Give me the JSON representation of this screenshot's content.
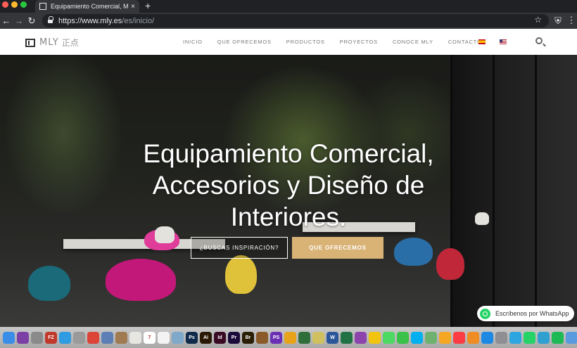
{
  "browser": {
    "tab_title": "Equipamiento Comercial, Mobili",
    "tab_close": "×",
    "new_tab": "+",
    "url_host": "https://www.mly.es",
    "url_path": "/es/inicio/"
  },
  "header": {
    "logo_text": "MLY",
    "logo_cn": "正点",
    "menu": [
      "INICIO",
      "QUE OFRECEMOS",
      "PRODUCTOS",
      "PROYECTOS",
      "CONOCE MLY",
      "CONTACTO"
    ]
  },
  "hero": {
    "title_line1": "Equipamiento Comercial,",
    "title_line2": "Accesorios y Diseño de",
    "title_line3": "Interiores.",
    "btn_inspiration": "¿BUSCAS INSPIRACIÓN?",
    "btn_offer": "QUE OFRECEMOS"
  },
  "whatsapp": {
    "label": "Escríbenos por WhatsApp"
  },
  "colors": {
    "accent_gold": "#d9b275",
    "whatsapp_green": "#25d366"
  },
  "dock_icons": [
    {
      "name": "finder-icon",
      "color": "#3b8ee8",
      "label": ""
    },
    {
      "name": "siri-icon",
      "color": "#7b3fa5",
      "label": ""
    },
    {
      "name": "launchpad-icon",
      "color": "#8a8a8a",
      "label": ""
    },
    {
      "name": "filezilla-icon",
      "color": "#c0392b",
      "label": "FZ"
    },
    {
      "name": "safari-icon",
      "color": "#2f9be0",
      "label": ""
    },
    {
      "name": "tools-icon",
      "color": "#9a9a9a",
      "label": ""
    },
    {
      "name": "chrome-icon",
      "color": "#db4437",
      "label": ""
    },
    {
      "name": "photos-icon",
      "color": "#5d7fb5",
      "label": ""
    },
    {
      "name": "contacts-icon",
      "color": "#a07a50",
      "label": ""
    },
    {
      "name": "notes-icon",
      "color": "#e8e6e0",
      "label": ""
    },
    {
      "name": "calendar-icon",
      "color": "#ffffff",
      "label": "7"
    },
    {
      "name": "textedit-icon",
      "color": "#f3f3f3",
      "label": ""
    },
    {
      "name": "preview-icon",
      "color": "#7fa8c9",
      "label": ""
    },
    {
      "name": "photoshop-icon",
      "color": "#0f2a4a",
      "label": "Ps"
    },
    {
      "name": "illustrator-icon",
      "color": "#2a1a05",
      "label": "Ai"
    },
    {
      "name": "indesign-icon",
      "color": "#3a0a25",
      "label": "Id"
    },
    {
      "name": "premiere-icon",
      "color": "#1a0a3a",
      "label": "Pr"
    },
    {
      "name": "bridge-icon",
      "color": "#2a1e05",
      "label": "Br"
    },
    {
      "name": "vectorize-icon",
      "color": "#8b5a2b",
      "label": ""
    },
    {
      "name": "phpstorm-icon",
      "color": "#6b2fb5",
      "label": "PS"
    },
    {
      "name": "sketch-icon",
      "color": "#e8a31a",
      "label": ""
    },
    {
      "name": "app-icon",
      "color": "#2f6e3a",
      "label": ""
    },
    {
      "name": "app-icon-2",
      "color": "#d0c060",
      "label": ""
    },
    {
      "name": "word-icon",
      "color": "#2b579a",
      "label": "W"
    },
    {
      "name": "excel-icon",
      "color": "#217346",
      "label": ""
    },
    {
      "name": "app-icon-3",
      "color": "#8e44ad",
      "label": ""
    },
    {
      "name": "app-icon-4",
      "color": "#f1c40f",
      "label": ""
    },
    {
      "name": "messages-icon",
      "color": "#4cd964",
      "label": ""
    },
    {
      "name": "facetime-icon",
      "color": "#3ac14a",
      "label": ""
    },
    {
      "name": "skype-icon",
      "color": "#00aff0",
      "label": ""
    },
    {
      "name": "maps-icon",
      "color": "#6fb26f",
      "label": ""
    },
    {
      "name": "photos-app-icon",
      "color": "#f5a623",
      "label": ""
    },
    {
      "name": "music-icon",
      "color": "#fc3c44",
      "label": ""
    },
    {
      "name": "books-icon",
      "color": "#f08c24",
      "label": ""
    },
    {
      "name": "appstore-icon",
      "color": "#1e88e5",
      "label": ""
    },
    {
      "name": "settings-icon",
      "color": "#8e8e93",
      "label": ""
    },
    {
      "name": "telegram-icon",
      "color": "#2ca5e0",
      "label": ""
    },
    {
      "name": "whatsapp-dock-icon",
      "color": "#25d366",
      "label": ""
    },
    {
      "name": "app-icon-5",
      "color": "#30a0d0",
      "label": ""
    },
    {
      "name": "spotify-icon",
      "color": "#1db954",
      "label": ""
    },
    {
      "name": "downloads-icon",
      "color": "#5a9be0",
      "label": ""
    },
    {
      "name": "documents-icon",
      "color": "#7fb0e0",
      "label": ""
    },
    {
      "name": "trash-icon",
      "color": "#d8d8d8",
      "label": ""
    }
  ]
}
